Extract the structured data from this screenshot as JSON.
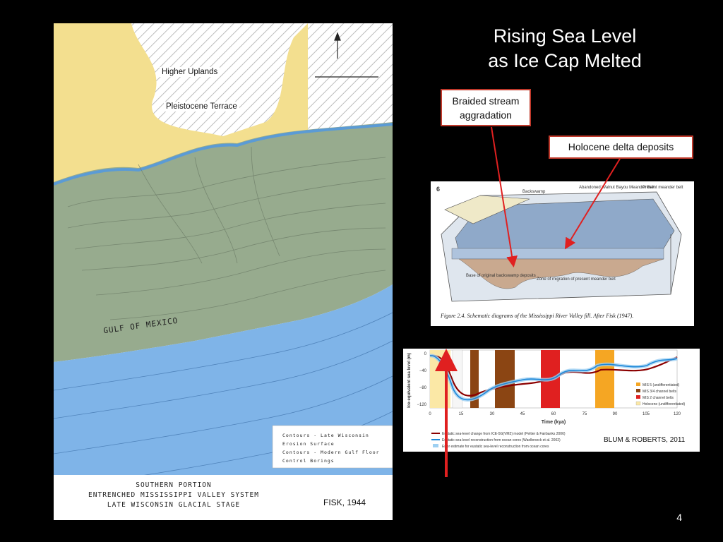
{
  "slide": {
    "title_line1": "Rising Sea Level",
    "title_line2": "as  Ice Cap Melted",
    "callout_braided": "Braided stream aggradation",
    "callout_holocene": "Holocene delta deposits",
    "page_number": "4"
  },
  "map": {
    "label_uplands": "Higher Uplands",
    "label_terrace": "Pleistocene Terrace",
    "label_gulf": "GULF   OF   MEXICO",
    "caption_line1": "SOUTHERN PORTION",
    "caption_line2": "ENTRENCHED MISSISSIPPI VALLEY SYSTEM",
    "caption_line3": "LATE WISCONSIN GLACIAL STAGE",
    "credit": "FISK, 1944",
    "legend": [
      "Contours - Late Wisconsin Erosion Surface",
      "Contours - Modern Gulf Floor",
      "Control Borings"
    ],
    "colors": {
      "uplands": "#f3df8f",
      "terrace_blue": "#5b9bd5",
      "valley_green": "#97ab8e",
      "gulf": "#7fb4e8"
    }
  },
  "block_diagram": {
    "figure_number": "6",
    "labels": [
      "Backswamp",
      "Abandoned Walnut Bayou Meander Belt",
      "Present meander belt",
      "Base of original backswamp deposits",
      "Zone of migration of present meander belt"
    ],
    "caption": "Figure 2.4.  Schematic diagrams of the Mississippi River Valley fill.  After Fisk (1947)."
  },
  "sea_level_chart": {
    "y_axis_label": "Ice-equivalent sea level (m)",
    "x_axis_label": "Time (kya)",
    "y_ticks": [
      "0",
      "−40",
      "−80",
      "−120"
    ],
    "x_ticks": [
      "0",
      "15",
      "30",
      "45",
      "60",
      "75",
      "90",
      "105",
      "120"
    ],
    "legend": [
      "MIS 5 (undifferentiated)",
      "MIS 3/4 channel belts",
      "MIS 2 channel belts",
      "Holocene (undifferentiated)"
    ],
    "series_legend": [
      "Eustatic sea-level change from ICE-5G(VM2) model (Peltier & Fairbanks 2006)",
      "Eustatic sea-level reconstruction from ocean cores (Waelbroeck et al. 2002)",
      "Error estimate for eustatic sea-level reconstruction from ocean cores"
    ],
    "credit": "BLUM & ROBERTS, 2011",
    "colors": {
      "mis5": "#f5a623",
      "mis34": "#8b4513",
      "mis2": "#e02020",
      "holocene": "#fbe8a6",
      "model": "#8b0000",
      "cores": "#1e88d8"
    }
  }
}
